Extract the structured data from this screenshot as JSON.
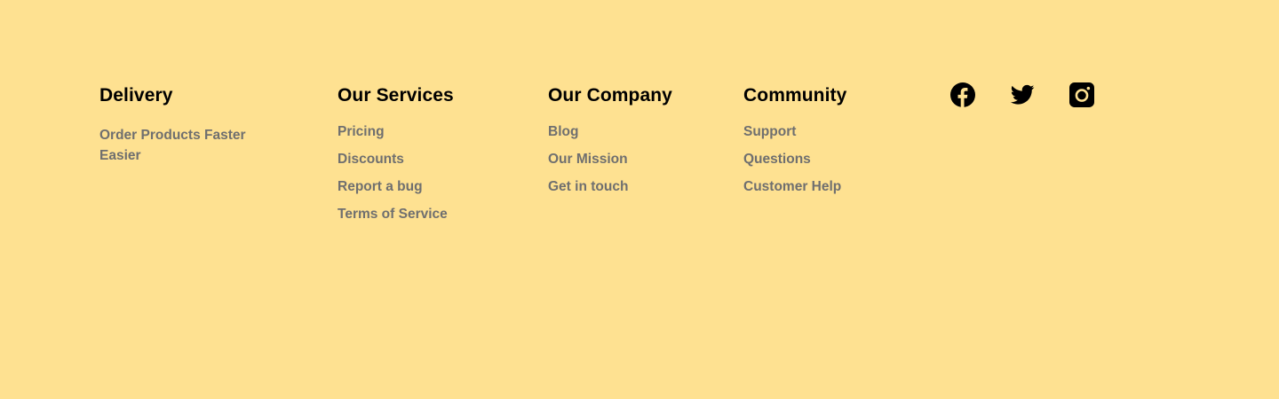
{
  "footer": {
    "delivery": {
      "title": "Delivery",
      "tagline": "Order Products Faster Easier"
    },
    "services": {
      "title": "Our Services",
      "links": [
        "Pricing",
        "Discounts",
        "Report a bug",
        "Terms of Service"
      ]
    },
    "company": {
      "title": "Our Company",
      "links": [
        "Blog",
        "Our Mission",
        "Get in touch"
      ]
    },
    "community": {
      "title": "Community",
      "links": [
        "Support",
        "Questions",
        "Customer Help"
      ]
    },
    "social": {
      "icons": [
        "facebook-icon",
        "twitter-icon",
        "instagram-icon"
      ]
    },
    "colors": {
      "background": "#FEE191",
      "heading": "#000000",
      "link": "#6F6F6F"
    }
  }
}
